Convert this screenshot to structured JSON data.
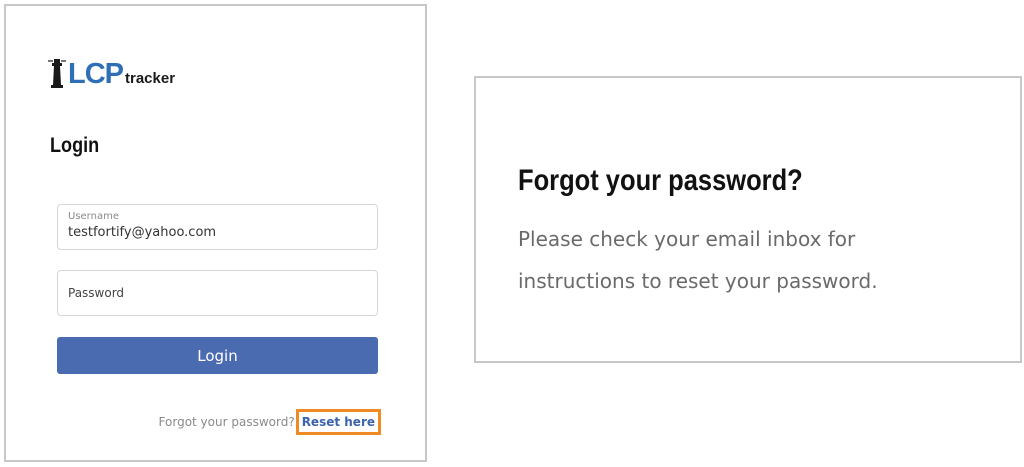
{
  "login_panel": {
    "logo": {
      "brand_main": "LCP",
      "brand_sub": "tracker",
      "icon": "lighthouse-icon",
      "brand_color": "#2f6fb8"
    },
    "heading": "Login",
    "username": {
      "label": "Username",
      "value": "testfortify@yahoo.com"
    },
    "password": {
      "placeholder": "Password"
    },
    "login_button_label": "Login",
    "forgot_text": "Forgot your password?",
    "reset_link_label": "Reset here",
    "accent_color": "#4b6bb1",
    "highlight_color": "#f08a24"
  },
  "forgot_panel": {
    "heading": "Forgot your password?",
    "message": "Please check your email inbox for instructions to reset your password."
  }
}
